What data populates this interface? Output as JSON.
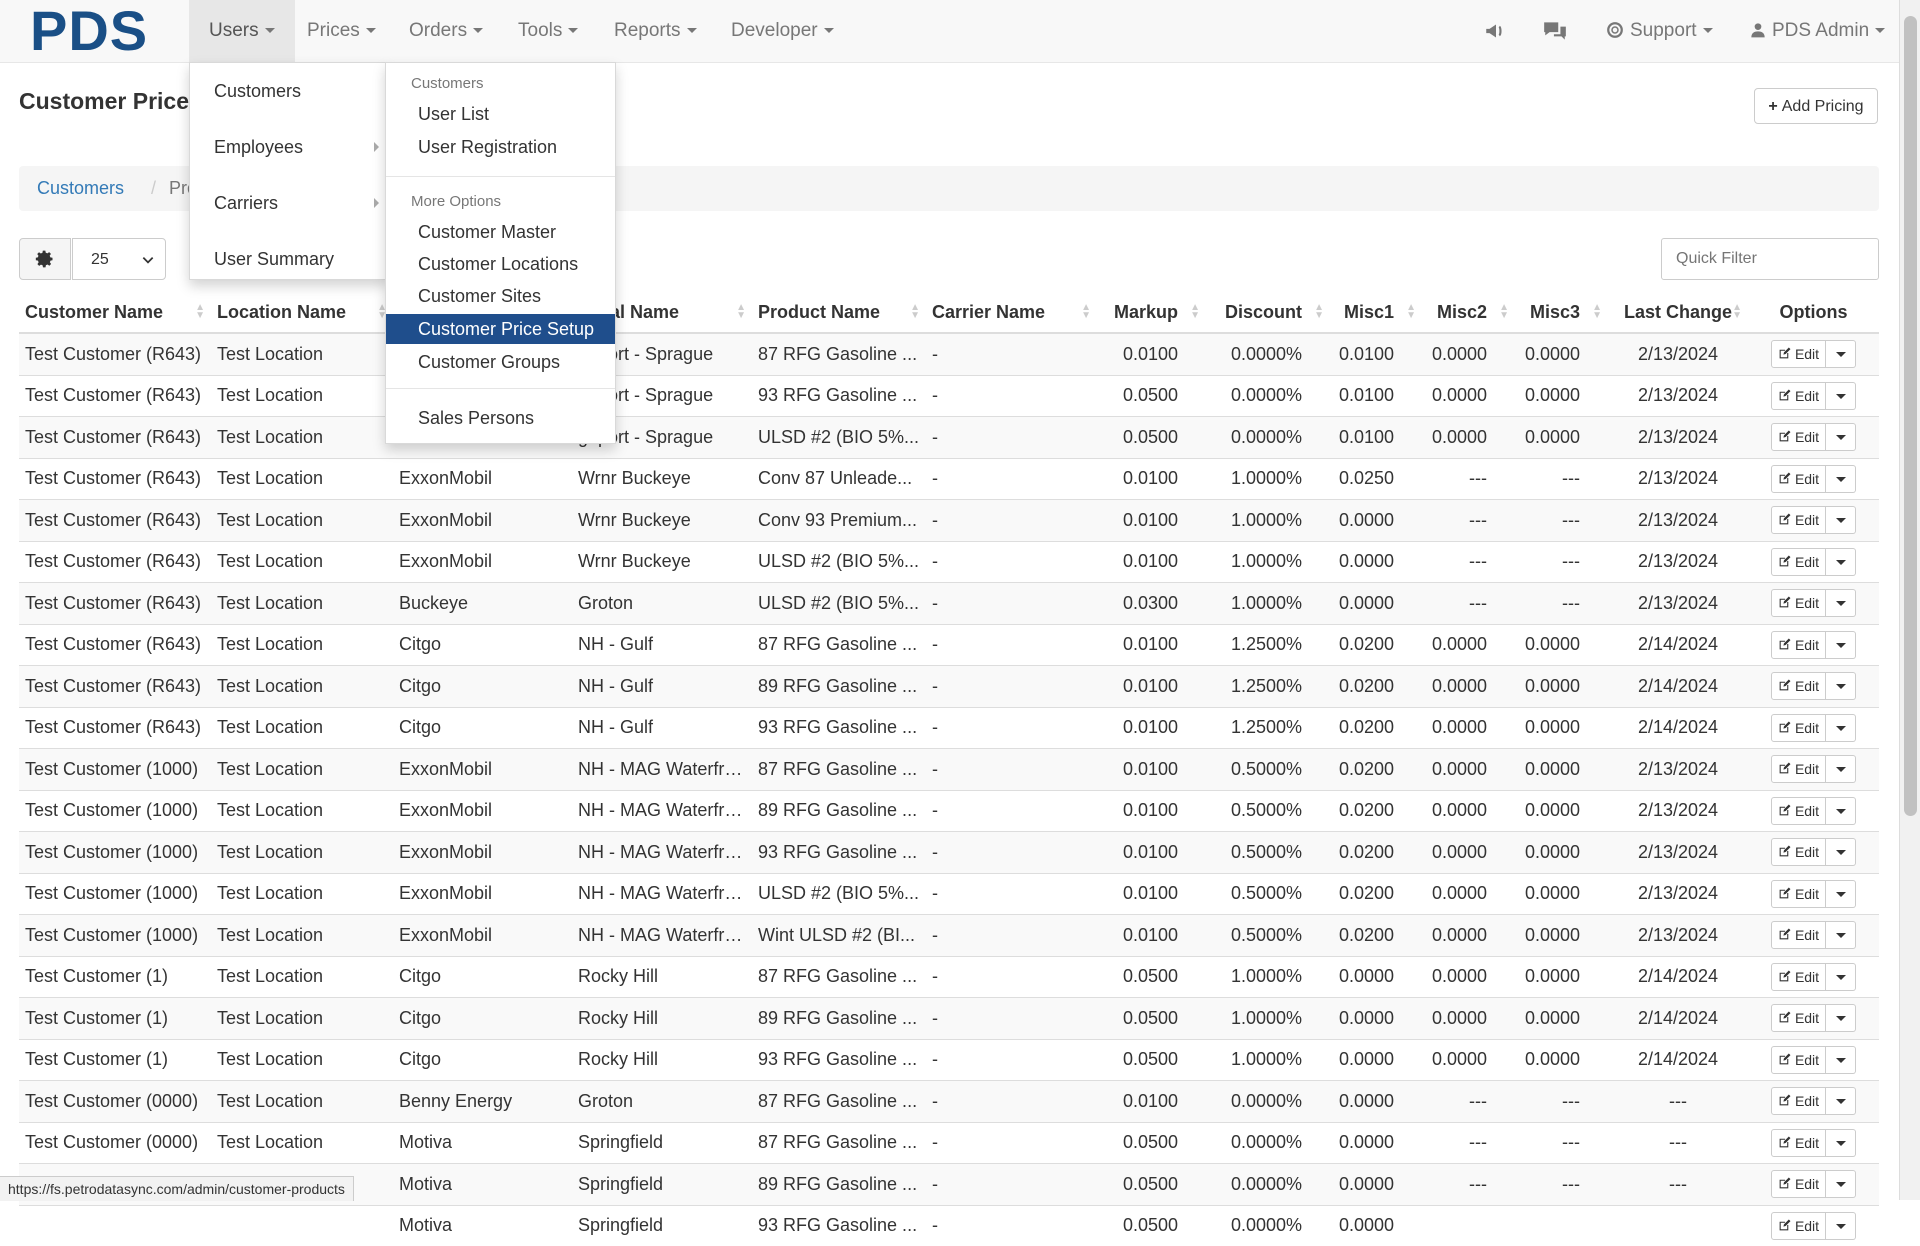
{
  "brand": "PDS",
  "nav": {
    "items": [
      "Users",
      "Prices",
      "Orders",
      "Tools",
      "Reports",
      "Developer"
    ],
    "support": "Support",
    "user": "PDS Admin"
  },
  "page": {
    "title": "Customer Price",
    "add_button": "Add Pricing"
  },
  "breadcrumb": {
    "link": "Customers",
    "separator": "/",
    "current": "Produ"
  },
  "controls": {
    "page_size": "25",
    "quick_filter_placeholder": "Quick Filter"
  },
  "table": {
    "columns": [
      "Customer Name",
      "Location Name",
      "",
      "minal Name",
      "Product Name",
      "Carrier Name",
      "Markup",
      "Discount",
      "Misc1",
      "Misc2",
      "Misc3",
      "Last Change",
      "Options"
    ],
    "edit_label": "Edit",
    "rows": [
      [
        "Test Customer (R643)",
        "Test Location",
        "",
        "geport - Sprague",
        "87 RFG Gasoline ...",
        "-",
        "0.0100",
        "0.0000%",
        "0.0100",
        "0.0000",
        "0.0000",
        "2/13/2024"
      ],
      [
        "Test Customer (R643)",
        "Test Location",
        "",
        "geport - Sprague",
        "93 RFG Gasoline ...",
        "-",
        "0.0500",
        "0.0000%",
        "0.0100",
        "0.0000",
        "0.0000",
        "2/13/2024"
      ],
      [
        "Test Customer (R643)",
        "Test Location",
        "",
        "geport - Sprague",
        "ULSD #2 (BIO 5%...",
        "-",
        "0.0500",
        "0.0000%",
        "0.0100",
        "0.0000",
        "0.0000",
        "2/13/2024"
      ],
      [
        "Test Customer (R643)",
        "Test Location",
        "ExxonMobil",
        "Wrnr Buckeye",
        "Conv 87 Unleade...",
        "-",
        "0.0100",
        "1.0000%",
        "0.0250",
        "---",
        "---",
        "2/13/2024"
      ],
      [
        "Test Customer (R643)",
        "Test Location",
        "ExxonMobil",
        "Wrnr Buckeye",
        "Conv 93 Premium...",
        "-",
        "0.0100",
        "1.0000%",
        "0.0000",
        "---",
        "---",
        "2/13/2024"
      ],
      [
        "Test Customer (R643)",
        "Test Location",
        "ExxonMobil",
        "Wrnr Buckeye",
        "ULSD #2 (BIO 5%...",
        "-",
        "0.0100",
        "1.0000%",
        "0.0000",
        "---",
        "---",
        "2/13/2024"
      ],
      [
        "Test Customer (R643)",
        "Test Location",
        "Buckeye",
        "Groton",
        "ULSD #2 (BIO 5%...",
        "-",
        "0.0300",
        "1.0000%",
        "0.0000",
        "---",
        "---",
        "2/13/2024"
      ],
      [
        "Test Customer (R643)",
        "Test Location",
        "Citgo",
        "NH - Gulf",
        "87 RFG Gasoline ...",
        "-",
        "0.0100",
        "1.2500%",
        "0.0200",
        "0.0000",
        "0.0000",
        "2/14/2024"
      ],
      [
        "Test Customer (R643)",
        "Test Location",
        "Citgo",
        "NH - Gulf",
        "89 RFG Gasoline ...",
        "-",
        "0.0100",
        "1.2500%",
        "0.0200",
        "0.0000",
        "0.0000",
        "2/14/2024"
      ],
      [
        "Test Customer (R643)",
        "Test Location",
        "Citgo",
        "NH - Gulf",
        "93 RFG Gasoline ...",
        "-",
        "0.0100",
        "1.2500%",
        "0.0200",
        "0.0000",
        "0.0000",
        "2/14/2024"
      ],
      [
        "Test Customer (1000)",
        "Test Location",
        "ExxonMobil",
        "NH - MAG Waterfront",
        "87 RFG Gasoline ...",
        "-",
        "0.0100",
        "0.5000%",
        "0.0200",
        "0.0000",
        "0.0000",
        "2/13/2024"
      ],
      [
        "Test Customer (1000)",
        "Test Location",
        "ExxonMobil",
        "NH - MAG Waterfront",
        "89 RFG Gasoline ...",
        "-",
        "0.0100",
        "0.5000%",
        "0.0200",
        "0.0000",
        "0.0000",
        "2/13/2024"
      ],
      [
        "Test Customer (1000)",
        "Test Location",
        "ExxonMobil",
        "NH - MAG Waterfront",
        "93 RFG Gasoline ...",
        "-",
        "0.0100",
        "0.5000%",
        "0.0200",
        "0.0000",
        "0.0000",
        "2/13/2024"
      ],
      [
        "Test Customer (1000)",
        "Test Location",
        "ExxonMobil",
        "NH - MAG Waterfront",
        "ULSD #2 (BIO 5%...",
        "-",
        "0.0100",
        "0.5000%",
        "0.0200",
        "0.0000",
        "0.0000",
        "2/13/2024"
      ],
      [
        "Test Customer (1000)",
        "Test Location",
        "ExxonMobil",
        "NH - MAG Waterfront",
        "Wint ULSD #2 (BI...",
        "-",
        "0.0100",
        "0.5000%",
        "0.0200",
        "0.0000",
        "0.0000",
        "2/13/2024"
      ],
      [
        "Test Customer (1)",
        "Test Location",
        "Citgo",
        "Rocky Hill",
        "87 RFG Gasoline ...",
        "-",
        "0.0500",
        "1.0000%",
        "0.0000",
        "0.0000",
        "0.0000",
        "2/14/2024"
      ],
      [
        "Test Customer (1)",
        "Test Location",
        "Citgo",
        "Rocky Hill",
        "89 RFG Gasoline ...",
        "-",
        "0.0500",
        "1.0000%",
        "0.0000",
        "0.0000",
        "0.0000",
        "2/14/2024"
      ],
      [
        "Test Customer (1)",
        "Test Location",
        "Citgo",
        "Rocky Hill",
        "93 RFG Gasoline ...",
        "-",
        "0.0500",
        "1.0000%",
        "0.0000",
        "0.0000",
        "0.0000",
        "2/14/2024"
      ],
      [
        "Test Customer (0000)",
        "Test Location",
        "Benny Energy",
        "Groton",
        "87 RFG Gasoline ...",
        "-",
        "0.0100",
        "0.0000%",
        "0.0000",
        "---",
        "---",
        "---"
      ],
      [
        "Test Customer (0000)",
        "Test Location",
        "Motiva",
        "Springfield",
        "87 RFG Gasoline ...",
        "-",
        "0.0500",
        "0.0000%",
        "0.0000",
        "---",
        "---",
        "---"
      ],
      [
        "Test Customer (0000)",
        "Test Location",
        "Motiva",
        "Springfield",
        "89 RFG Gasoline ...",
        "-",
        "0.0500",
        "0.0000%",
        "0.0000",
        "---",
        "---",
        "---"
      ],
      [
        "",
        "",
        "Motiva",
        "Springfield",
        "93 RFG Gasoline ...",
        "-",
        "0.0500",
        "0.0000%",
        "0.0000",
        "",
        "",
        ""
      ]
    ]
  },
  "users_menu": {
    "items": [
      "Customers",
      "Employees",
      "Carriers",
      "User Summary"
    ]
  },
  "customers_submenu": {
    "header1": "Customers",
    "group1": [
      "User List",
      "User Registration"
    ],
    "header2": "More Options",
    "group2": [
      "Customer Master",
      "Customer Locations",
      "Customer Sites",
      "Customer Price Setup",
      "Customer Groups"
    ],
    "group3": [
      "Sales Persons"
    ],
    "selected": "Customer Price Setup"
  },
  "status_bar": {
    "url": "https://fs.petrodatasync.com/admin/customer-products"
  },
  "colors": {
    "brand": "#1a4f86",
    "link": "#337ab7",
    "selected": "#1f4e8c"
  }
}
